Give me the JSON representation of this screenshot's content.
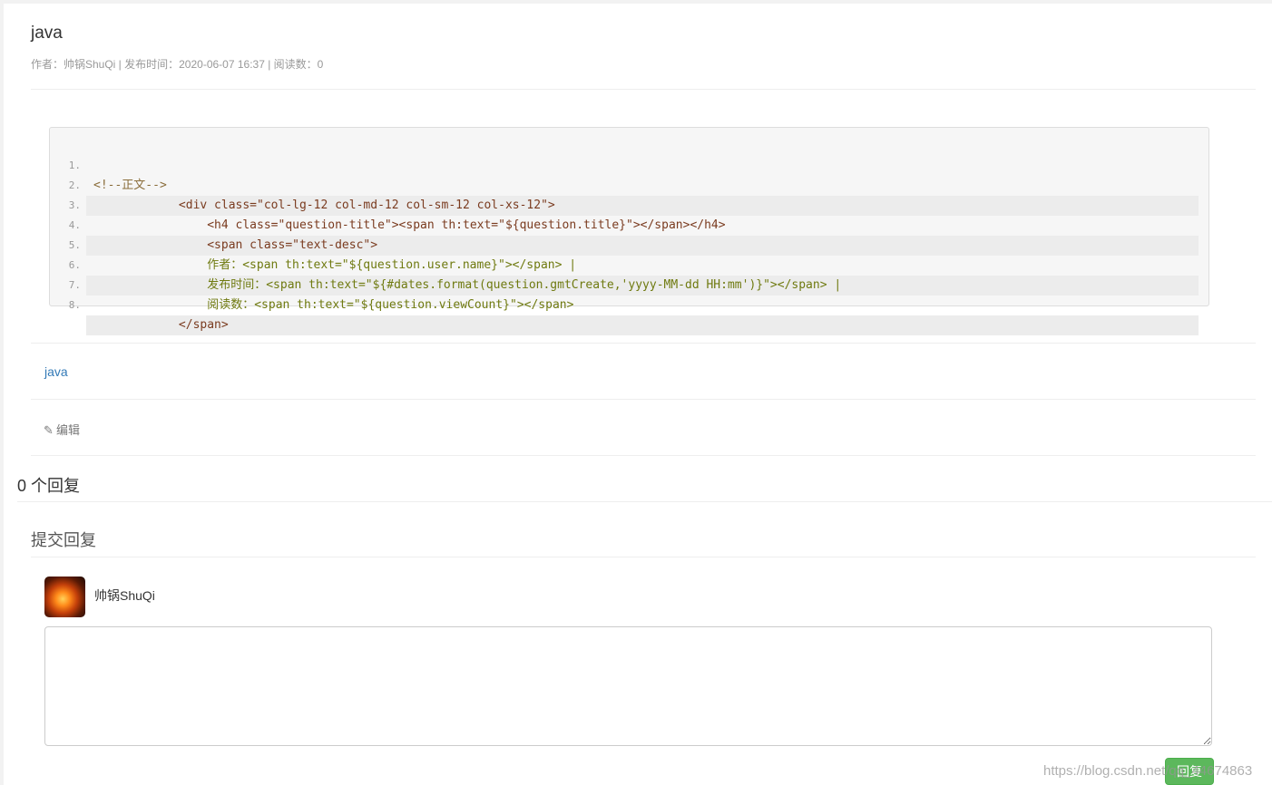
{
  "question": {
    "title": "java",
    "meta": "作者：帅锅ShuQi | 发布时间：2020-06-07 16:37 | 阅读数：0"
  },
  "code": {
    "line_numbers": [
      "1.",
      "2.",
      "3.",
      "4.",
      "5.",
      "6.",
      "7.",
      "8."
    ],
    "lines": [
      "<!--正文-->",
      "            <div class=\"col-lg-12 col-md-12 col-sm-12 col-xs-12\">",
      "                <h4 class=\"question-title\"><span th:text=\"${question.title}\"></span></h4>",
      "                <span class=\"text-desc\">",
      "                作者：<span th:text=\"${question.user.name}\"></span> |",
      "                发布时间：<span th:text=\"${#dates.format(question.gmtCreate,'yyyy-MM-dd HH:mm')}\"></span> |",
      "                阅读数：<span th:text=\"${question.viewCount}\"></span>",
      "            </span>"
    ]
  },
  "tag": "java",
  "edit_label": "编辑",
  "edit_icon": "pencil-icon",
  "reply_count_label": "0 个回复",
  "submit_reply_title": "提交回复",
  "current_user": {
    "name": "帅锅ShuQi"
  },
  "reply_textarea": {
    "value": "",
    "placeholder": ""
  },
  "reply_button_label": "回复",
  "watermark": "https://blog.csdn.net/qq_44674863",
  "colors": {
    "link": "#337ab7",
    "button": "#5cb85c"
  }
}
